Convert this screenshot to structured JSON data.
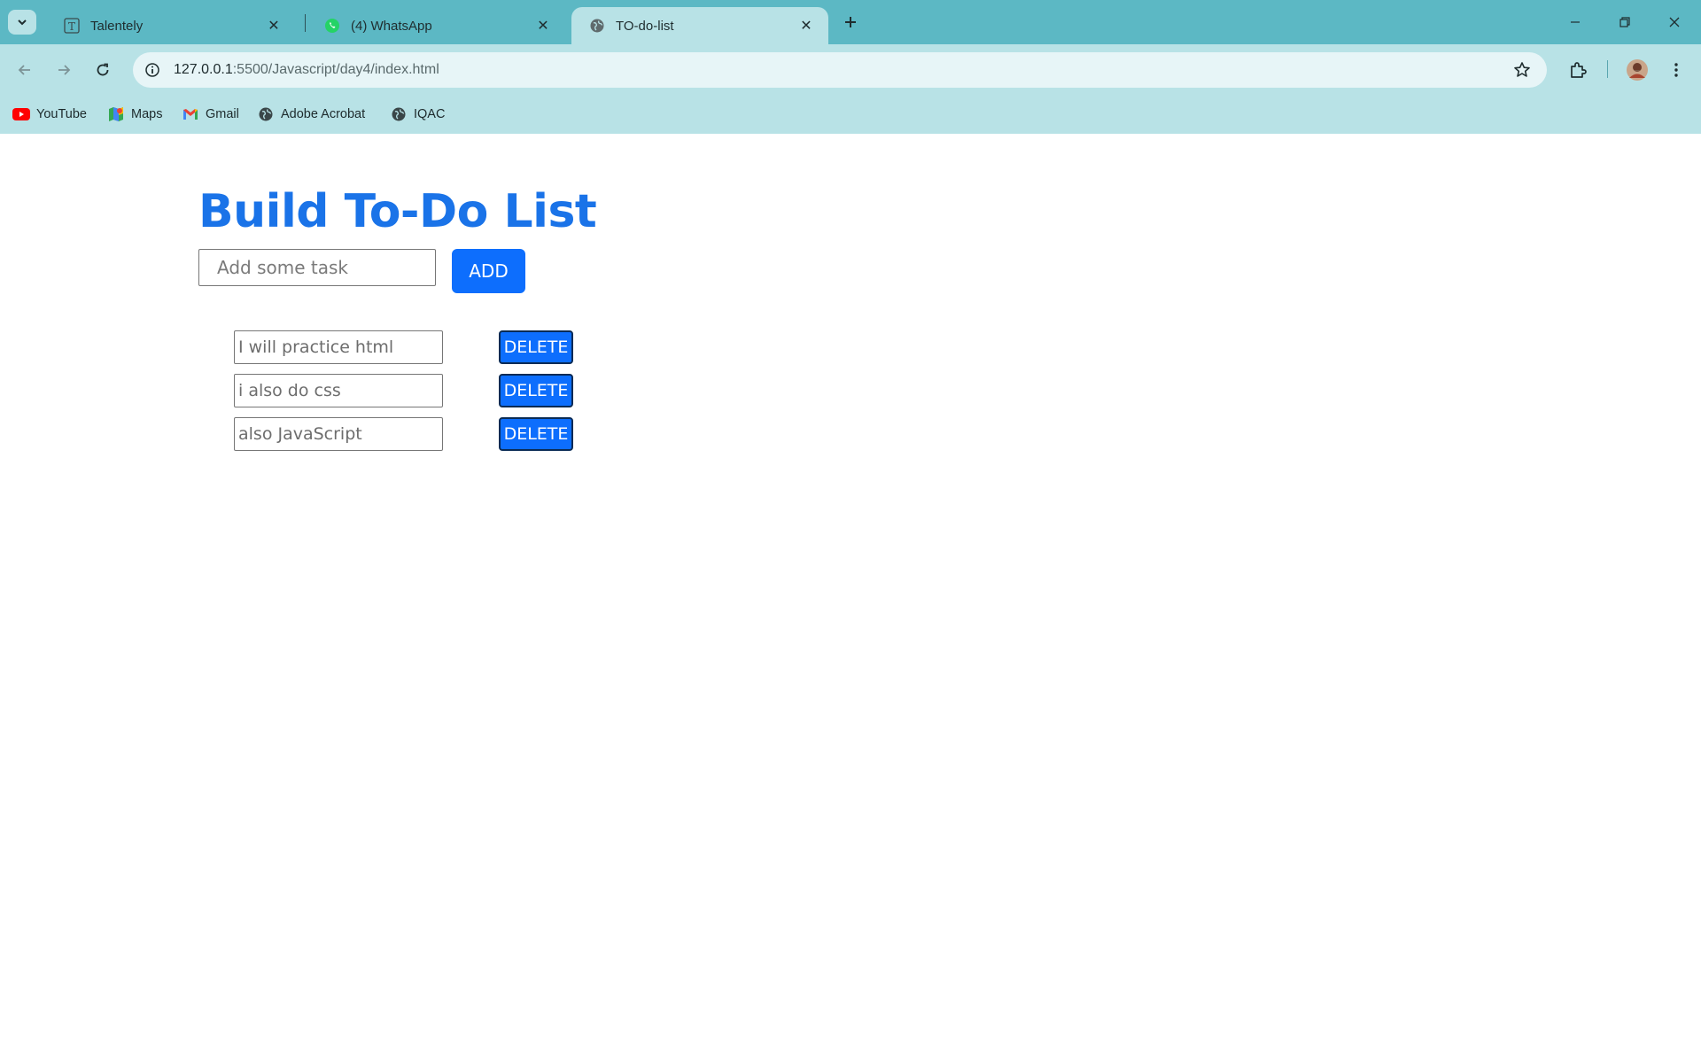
{
  "browser": {
    "tabs": [
      {
        "title": "Talentely",
        "icon": "talentely-icon",
        "active": false
      },
      {
        "title": "(4) WhatsApp",
        "icon": "whatsapp-icon",
        "active": false
      },
      {
        "title": "TO-do-list",
        "icon": "globe-icon",
        "active": true
      }
    ],
    "address": {
      "host": "127.0.0.1",
      "path": ":5500/Javascript/day4/index.html"
    },
    "bookmarks": [
      {
        "label": "YouTube",
        "icon": "youtube-icon"
      },
      {
        "label": "Maps",
        "icon": "maps-icon"
      },
      {
        "label": "Gmail",
        "icon": "gmail-icon"
      },
      {
        "label": "Adobe Acrobat",
        "icon": "globe-icon"
      },
      {
        "label": "IQAC",
        "icon": "globe-icon"
      }
    ],
    "colors": {
      "tabstrip": "#5cb8c4",
      "toolbar": "#b8e2e6",
      "omnibox": "#e7f5f7"
    }
  },
  "page": {
    "heading": "Build To-Do List",
    "input_placeholder": "Add some task",
    "add_label": "ADD",
    "tasks": [
      {
        "text": "I will practice html",
        "delete_label": "DELETE"
      },
      {
        "text": "i also do css",
        "delete_label": "DELETE"
      },
      {
        "text": "also JavaScript",
        "delete_label": "DELETE"
      }
    ],
    "colors": {
      "heading": "#1a73e8",
      "button": "#0d6efd"
    }
  }
}
